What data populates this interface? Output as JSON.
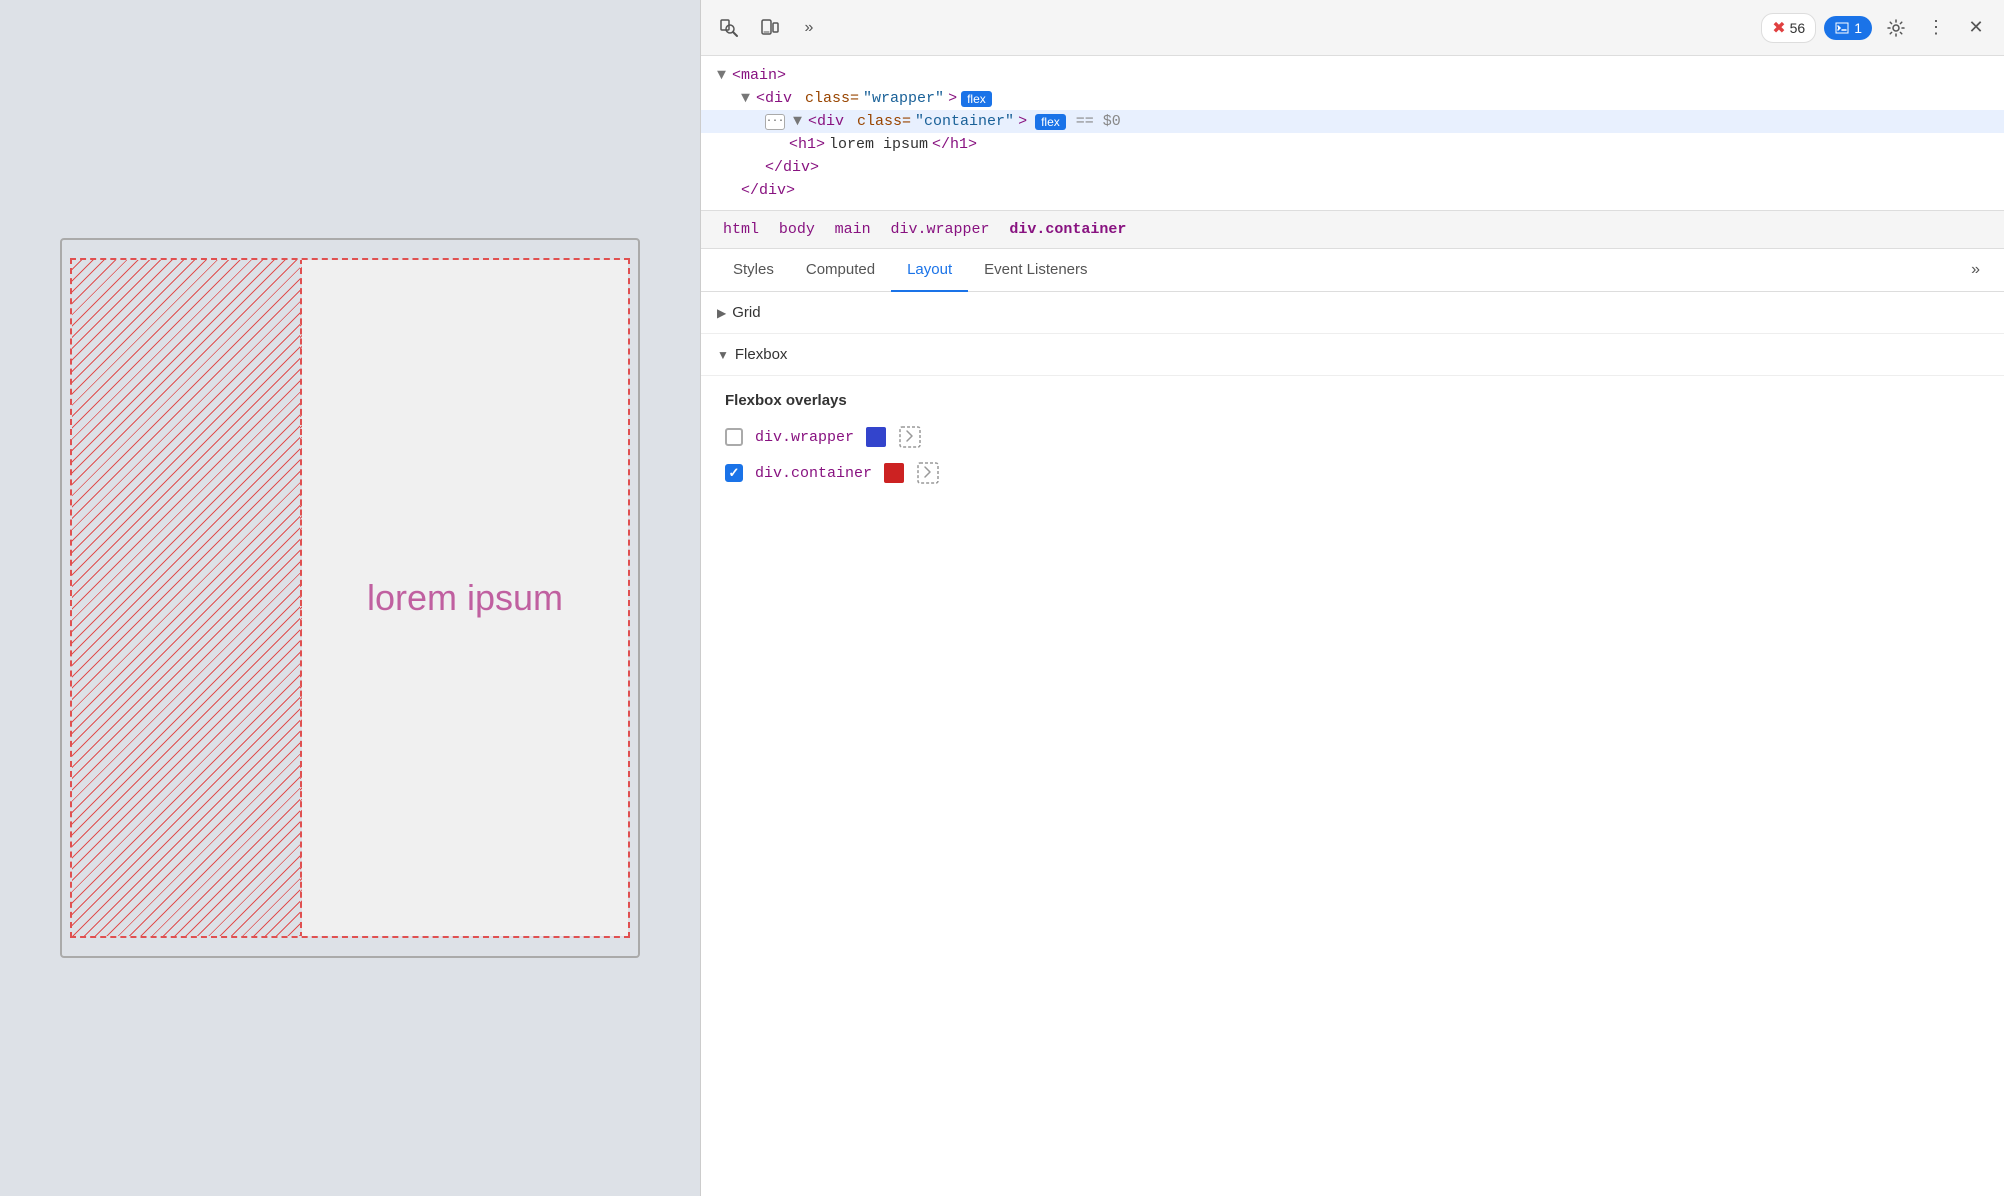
{
  "viewport": {
    "lorem_text": "lorem ipsum"
  },
  "devtools": {
    "toolbar": {
      "inspect_label": "Inspect",
      "device_label": "Device",
      "more_tools_label": "More tools",
      "errors_count": "56",
      "console_count": "1",
      "settings_label": "Settings",
      "more_label": "More",
      "close_label": "Close"
    },
    "html_tree": {
      "line1": "<main>",
      "line2_prefix": "<div class=",
      "line2_class": "\"wrapper\"",
      "line2_badge": "flex",
      "line3_prefix": "<div class=",
      "line3_class": "\"container\"",
      "line3_badge": "flex",
      "line3_equals": "== $0",
      "line4": "<h1>lorem ipsum</h1>",
      "line5": "</div>",
      "line6": "</div>"
    },
    "breadcrumb": {
      "items": [
        "html",
        "body",
        "main",
        "div.wrapper",
        "div.container"
      ]
    },
    "tabs": {
      "items": [
        "Styles",
        "Computed",
        "Layout",
        "Event Listeners"
      ],
      "active": "Layout"
    },
    "layout": {
      "grid_label": "Grid",
      "flexbox_label": "Flexbox",
      "flexbox_overlays_title": "Flexbox overlays",
      "wrapper_label": "div.wrapper",
      "wrapper_checked": false,
      "wrapper_color": "#3344cc",
      "container_label": "div.container",
      "container_checked": true,
      "container_color": "#cc2222"
    }
  }
}
